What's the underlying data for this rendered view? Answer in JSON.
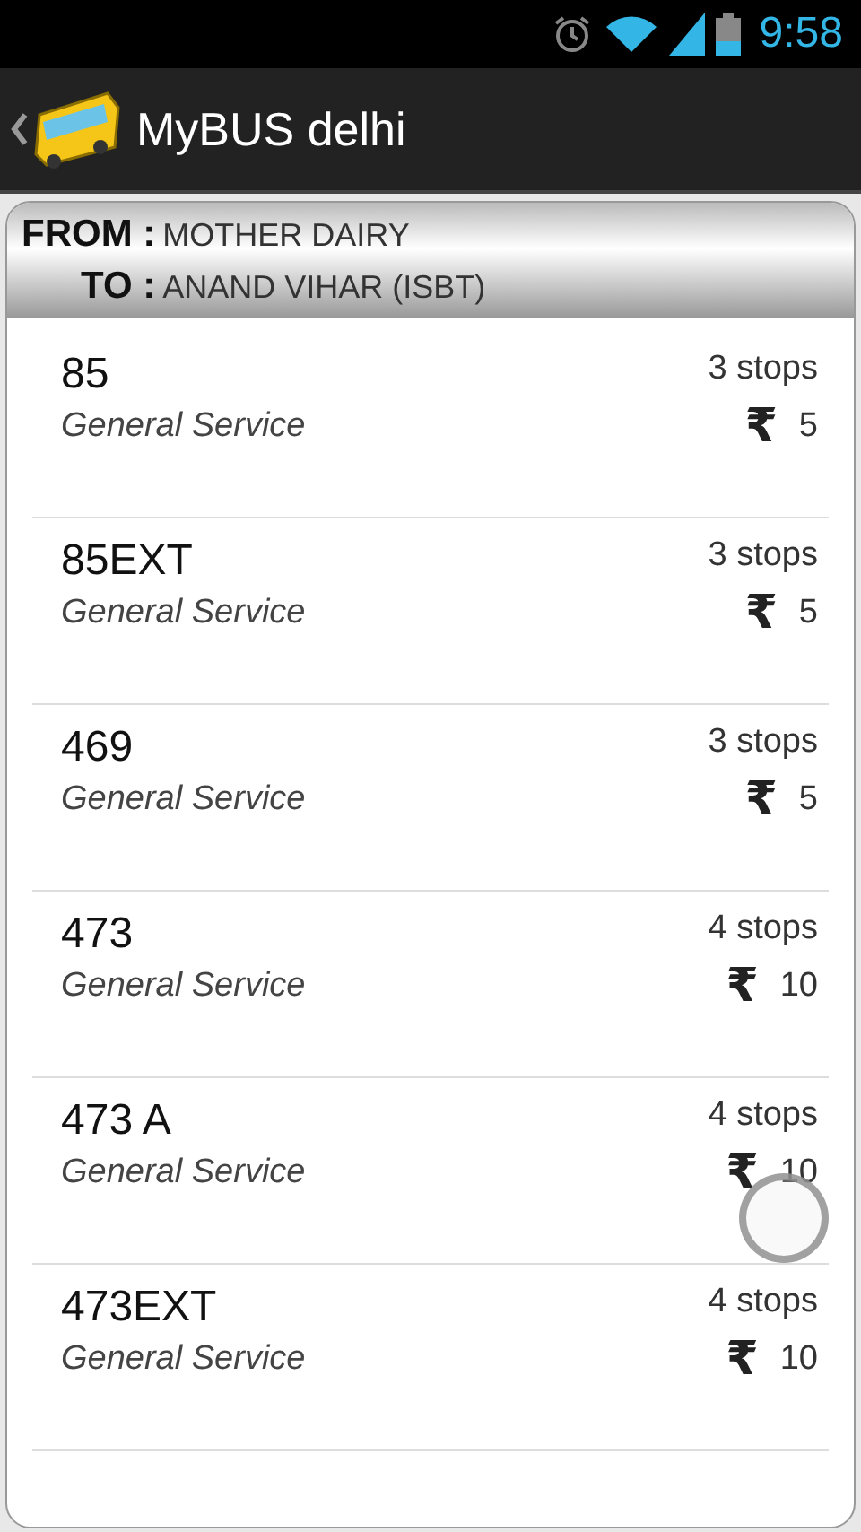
{
  "status_bar": {
    "time": "9:58"
  },
  "action_bar": {
    "title": "MyBUS delhi"
  },
  "route_header": {
    "from_label": "FROM :",
    "from": "MOTHER DAIRY",
    "to_label": "TO :",
    "to": "ANAND VIHAR (ISBT)"
  },
  "routes": [
    {
      "number": "85",
      "service": "General Service",
      "stops": "3 stops",
      "currency": "₹",
      "fare": "5",
      "touched": false
    },
    {
      "number": "85EXT",
      "service": "General Service",
      "stops": "3 stops",
      "currency": "₹",
      "fare": "5",
      "touched": false
    },
    {
      "number": "469",
      "service": "General Service",
      "stops": "3 stops",
      "currency": "₹",
      "fare": "5",
      "touched": false
    },
    {
      "number": "473",
      "service": "General Service",
      "stops": "4 stops",
      "currency": "₹",
      "fare": "10",
      "touched": false
    },
    {
      "number": "473 A",
      "service": "General Service",
      "stops": "4 stops",
      "currency": "₹",
      "fare": "10",
      "touched": true
    },
    {
      "number": "473EXT",
      "service": "General Service",
      "stops": "4 stops",
      "currency": "₹",
      "fare": "10",
      "touched": false
    }
  ]
}
